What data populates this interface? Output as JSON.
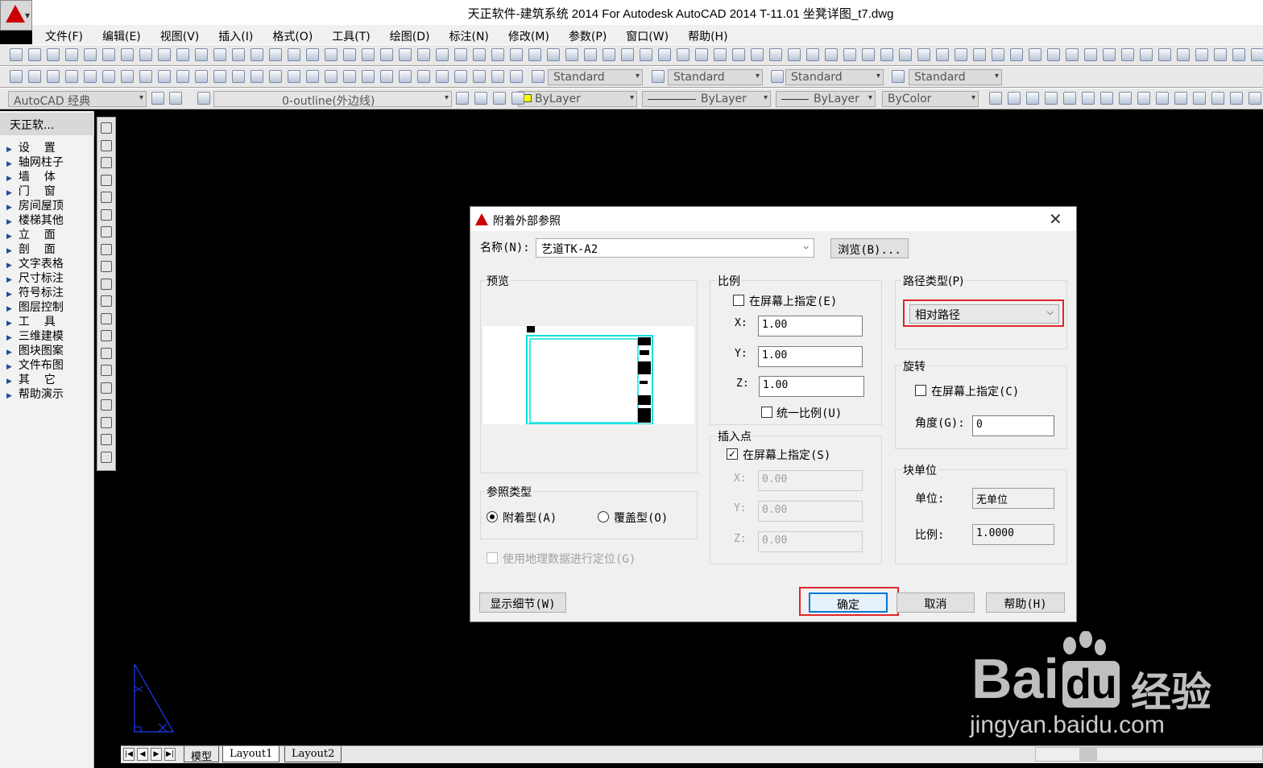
{
  "window": {
    "title": "天正软件-建筑系统 2014  For Autodesk AutoCAD 2014    T-11.01 坐凳详图_t7.dwg"
  },
  "menu": [
    "文件(F)",
    "编辑(E)",
    "视图(V)",
    "插入(I)",
    "格式(O)",
    "工具(T)",
    "绘图(D)",
    "标注(N)",
    "修改(M)",
    "参数(P)",
    "窗口(W)",
    "帮助(H)"
  ],
  "toolbar2": {
    "style1": "Standard",
    "style2": "Standard",
    "style3": "Standard",
    "style4": "Standard"
  },
  "toolbar3": {
    "workspace": "AutoCAD 经典",
    "layer": "0-outline(外边线)",
    "color": "ByLayer",
    "linetype": "ByLayer",
    "lineweight": "ByLayer",
    "plotstyle": "ByColor"
  },
  "palette": {
    "title": "天正软...",
    "items": [
      "设    置",
      "轴网柱子",
      "墙    体",
      "门    窗",
      "房间屋顶",
      "楼梯其他",
      "立    面",
      "剖    面",
      "文字表格",
      "尺寸标注",
      "符号标注",
      "图层控制",
      "工    具",
      "三维建模",
      "图块图案",
      "文件布图",
      "其    它",
      "帮助演示"
    ]
  },
  "tabs": {
    "model": "模型",
    "layout1": "Layout1",
    "layout2": "Layout2"
  },
  "dialog": {
    "title": "附着外部参照",
    "name_label": "名称(N):",
    "name_value": "艺道TK-A2",
    "browse": "浏览(B)...",
    "preview_label": "预览",
    "scale": {
      "label": "比例",
      "on_screen": "在屏幕上指定(E)",
      "x_label": "X:",
      "x": "1.00",
      "y_label": "Y:",
      "y": "1.00",
      "z_label": "Z:",
      "z": "1.00",
      "uniform": "统一比例(U)"
    },
    "insert": {
      "label": "插入点",
      "on_screen": "在屏幕上指定(S)",
      "x_label": "X:",
      "x": "0.00",
      "y_label": "Y:",
      "y": "0.00",
      "z_label": "Z:",
      "z": "0.00"
    },
    "path": {
      "label": "路径类型(P)",
      "value": "相对路径"
    },
    "rotation": {
      "label": "旋转",
      "on_screen": "在屏幕上指定(C)",
      "angle_label": "角度(G):",
      "angle": "0"
    },
    "unit": {
      "label": "块单位",
      "unit_label": "单位:",
      "unit_value": "无单位",
      "factor_label": "比例:",
      "factor_value": "1.0000"
    },
    "ref_type": {
      "label": "参照类型",
      "attach": "附着型(A)",
      "overlay": "覆盖型(O)"
    },
    "geo": "使用地理数据进行定位(G)",
    "details": "显示细节(W)",
    "ok": "确定",
    "cancel": "取消",
    "help": "帮助(H)"
  },
  "watermark": {
    "brand": "Bai",
    "brand2": "du",
    "cn": "经验",
    "url": "jingyan.baidu.com"
  },
  "colors": {
    "highlight": "#e0262a",
    "cyan": "#00e0e0",
    "ucs": "#1a3cff"
  }
}
